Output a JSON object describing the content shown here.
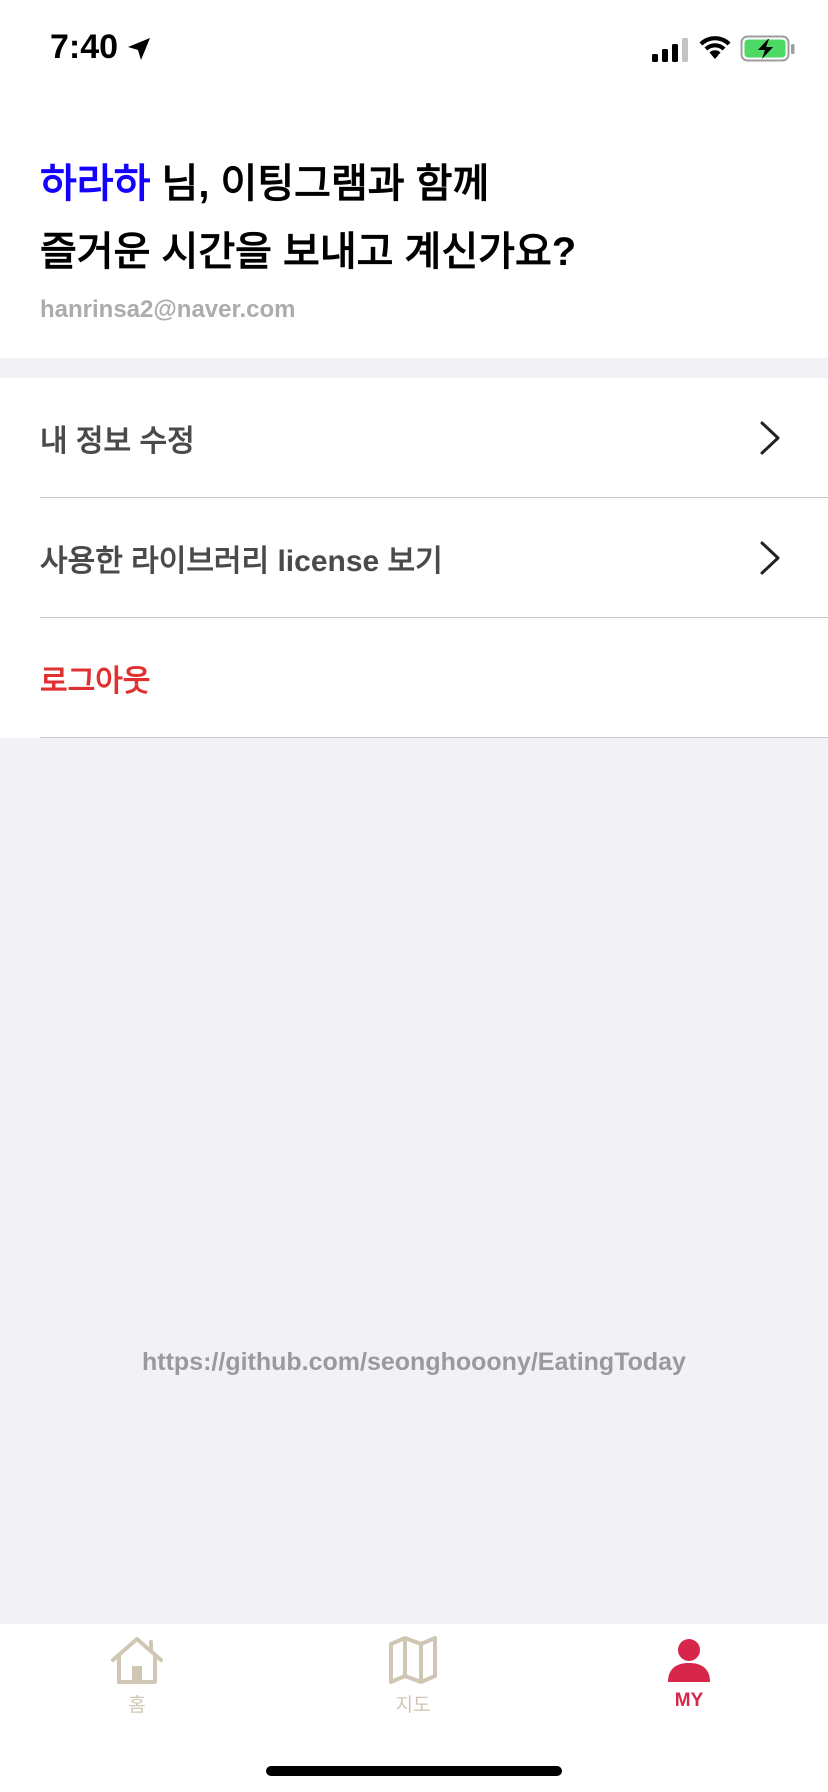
{
  "status_bar": {
    "time": "7:40",
    "icons": [
      "location-arrow-icon",
      "cellular-signal-icon",
      "wifi-icon",
      "battery-charging-icon"
    ]
  },
  "header": {
    "user_name": "하라하",
    "greeting_line1_suffix": " 님, 이팅그램과 함께",
    "greeting_line2": "즐거운 시간을 보내고 계신가요?",
    "email": "hanrinsa2@naver.com"
  },
  "menu": {
    "edit_profile": "내 정보 수정",
    "licenses": "사용한 라이브러리 license 보기",
    "logout": "로그아웃"
  },
  "footer": {
    "repo_url": "https://github.com/seonghooony/EatingToday"
  },
  "tabs": [
    {
      "label": "홈",
      "icon": "home-icon",
      "active": false
    },
    {
      "label": "지도",
      "icon": "map-icon",
      "active": false
    },
    {
      "label": "MY",
      "icon": "person-icon",
      "active": true
    }
  ],
  "colors": {
    "accent_name": "#1400ff",
    "logout": "#e03030",
    "tab_active": "#d8264a",
    "tab_inactive": "#cfc7b4",
    "background": "#f1f1f6"
  }
}
